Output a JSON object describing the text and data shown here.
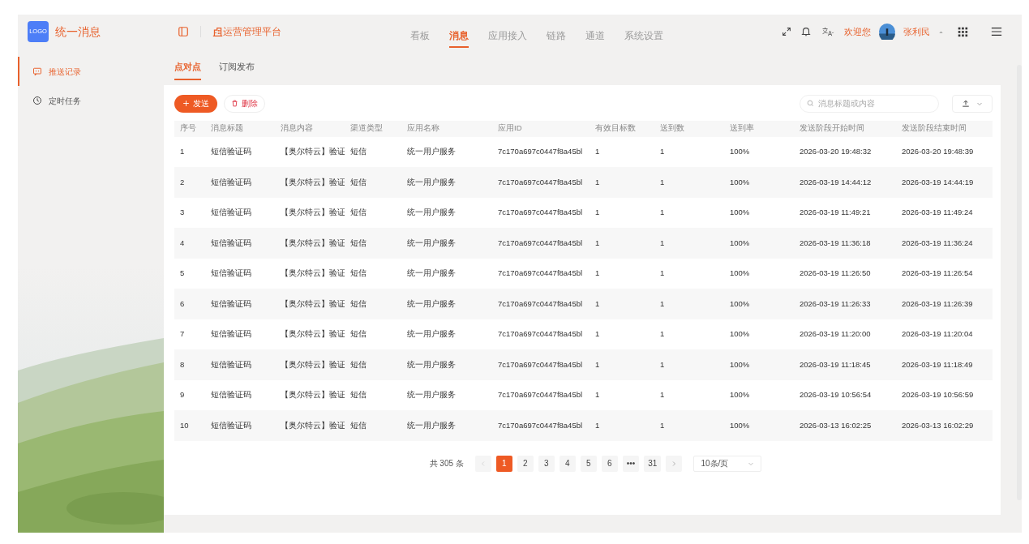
{
  "header": {
    "logo": "LOGO",
    "app_name": "统一消息",
    "platform": "运营管理平台",
    "nav": [
      {
        "label": "看板",
        "selected": false
      },
      {
        "label": "消息",
        "selected": true
      },
      {
        "label": "应用接入",
        "selected": false
      },
      {
        "label": "链路",
        "selected": false
      },
      {
        "label": "通道",
        "selected": false
      },
      {
        "label": "系统设置",
        "selected": false
      }
    ],
    "welcome": "欢迎您",
    "user": "张利民"
  },
  "sidebar": {
    "items": [
      {
        "label": "推送记录",
        "selected": true
      },
      {
        "label": "定时任务",
        "selected": false
      }
    ]
  },
  "tabs": [
    {
      "label": "点对点",
      "selected": true
    },
    {
      "label": "订阅发布",
      "selected": false
    }
  ],
  "toolbar": {
    "send": "发送",
    "delete": "删除",
    "search": {
      "placeholder": "消息标题或内容"
    }
  },
  "table": {
    "columns": [
      "序号",
      "消息标题",
      "消息内容",
      "渠道类型",
      "应用名称",
      "应用ID",
      "有效目标数",
      "送到数",
      "送到率",
      "发送阶段开始时间",
      "发送阶段结束时间"
    ],
    "rows": [
      [
        "1",
        "短信验证码",
        "【奥尔特云】验证",
        "短信",
        "统一用户服务",
        "7c170a697c0447f8a45bl",
        "1",
        "1",
        "100%",
        "2026-03-20 19:48:32",
        "2026-03-20 19:48:39"
      ],
      [
        "2",
        "短信验证码",
        "【奥尔特云】验证",
        "短信",
        "统一用户服务",
        "7c170a697c0447f8a45bl",
        "1",
        "1",
        "100%",
        "2026-03-19 14:44:12",
        "2026-03-19 14:44:19"
      ],
      [
        "3",
        "短信验证码",
        "【奥尔特云】验证",
        "短信",
        "统一用户服务",
        "7c170a697c0447f8a45bl",
        "1",
        "1",
        "100%",
        "2026-03-19 11:49:21",
        "2026-03-19 11:49:24"
      ],
      [
        "4",
        "短信验证码",
        "【奥尔特云】验证",
        "短信",
        "统一用户服务",
        "7c170a697c0447f8a45bl",
        "1",
        "1",
        "100%",
        "2026-03-19 11:36:18",
        "2026-03-19 11:36:24"
      ],
      [
        "5",
        "短信验证码",
        "【奥尔特云】验证",
        "短信",
        "统一用户服务",
        "7c170a697c0447f8a45bl",
        "1",
        "1",
        "100%",
        "2026-03-19 11:26:50",
        "2026-03-19 11:26:54"
      ],
      [
        "6",
        "短信验证码",
        "【奥尔特云】验证",
        "短信",
        "统一用户服务",
        "7c170a697c0447f8a45bl",
        "1",
        "1",
        "100%",
        "2026-03-19 11:26:33",
        "2026-03-19 11:26:39"
      ],
      [
        "7",
        "短信验证码",
        "【奥尔特云】验证",
        "短信",
        "统一用户服务",
        "7c170a697c0447f8a45bl",
        "1",
        "1",
        "100%",
        "2026-03-19 11:20:00",
        "2026-03-19 11:20:04"
      ],
      [
        "8",
        "短信验证码",
        "【奥尔特云】验证",
        "短信",
        "统一用户服务",
        "7c170a697c0447f8a45bl",
        "1",
        "1",
        "100%",
        "2026-03-19 11:18:45",
        "2026-03-19 11:18:49"
      ],
      [
        "9",
        "短信验证码",
        "【奥尔特云】验证",
        "短信",
        "统一用户服务",
        "7c170a697c0447f8a45bl",
        "1",
        "1",
        "100%",
        "2026-03-19 10:56:54",
        "2026-03-19 10:56:59"
      ],
      [
        "10",
        "短信验证码",
        "【奥尔特云】验证",
        "短信",
        "统一用户服务",
        "7c170a697c0447f8a45bl",
        "1",
        "1",
        "100%",
        "2026-03-13 16:02:25",
        "2026-03-13 16:02:29"
      ]
    ]
  },
  "pagination": {
    "total": "共 305 条",
    "pages": [
      {
        "label": "1",
        "selected": true
      },
      {
        "label": "2",
        "selected": false
      },
      {
        "label": "3",
        "selected": false
      },
      {
        "label": "4",
        "selected": false
      },
      {
        "label": "5",
        "selected": false
      },
      {
        "label": "6",
        "selected": false
      },
      {
        "label": "•••",
        "selected": false
      },
      {
        "label": "31",
        "selected": false
      }
    ],
    "page_size": "10条/页"
  }
}
